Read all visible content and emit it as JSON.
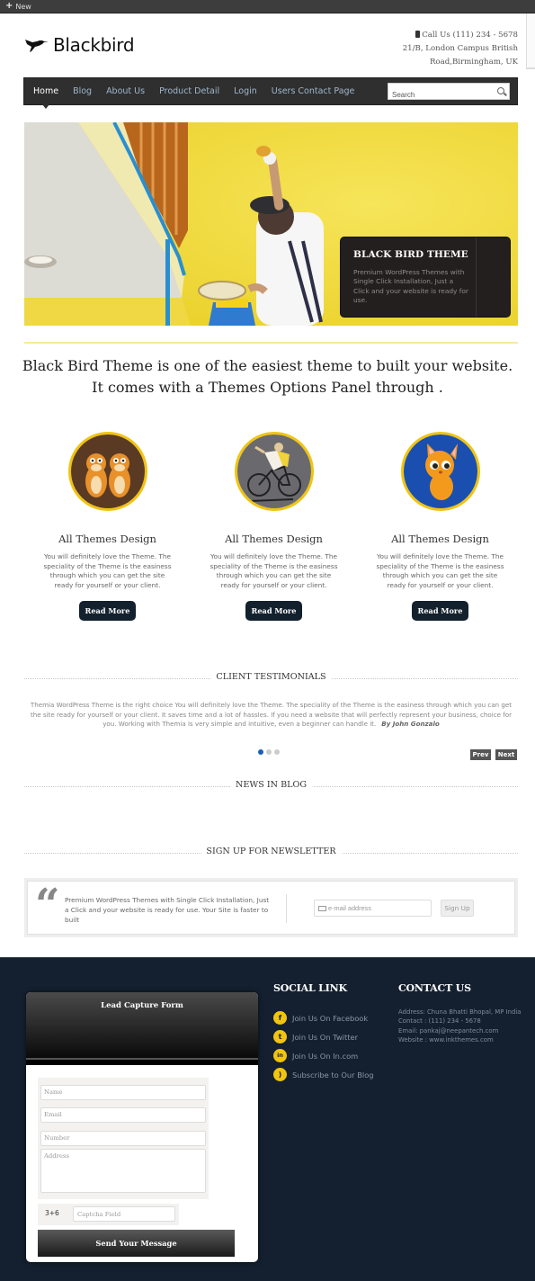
{
  "toolbar": {
    "new_label": "New"
  },
  "header": {
    "brand": "Blackbird",
    "phone": "Call Us (111) 234 - 5678",
    "address_line1": "21/B, London Campus British",
    "address_line2": "Road,Birmingham, UK"
  },
  "nav": {
    "items": [
      {
        "label": "Home",
        "active": true
      },
      {
        "label": "Blog"
      },
      {
        "label": "About Us"
      },
      {
        "label": "Product Detail"
      },
      {
        "label": "Login"
      },
      {
        "label": "Users Contact Page"
      }
    ],
    "search_placeholder": "Search"
  },
  "slider": {
    "caption_title": "BLACK BIRD THEME",
    "caption_text": "Premium WordPress Themes with Single Click Installation, Just a Click and your website is ready for use."
  },
  "tagline": {
    "line1": "Black Bird Theme is one of the easiest theme to built your website.",
    "line2": "It comes with a Themes Options Panel through ."
  },
  "features": [
    {
      "image": "tigers-illustration",
      "title": "All Themes Design",
      "text": "You will definitely love the Theme. The speciality of the Theme is the easiness through which you can get the site ready for yourself or your client.",
      "button": "Read More"
    },
    {
      "image": "cyclist-illustration",
      "title": "All Themes Design",
      "text": "You will definitely love the Theme. The speciality of the Theme is the easiness through which you can get the site ready for yourself or your client.",
      "button": "Read More"
    },
    {
      "image": "kitten-illustration",
      "title": "All Themes Design",
      "text": "You will definitely love the Theme. The speciality of the Theme is the easiness through which you can get the site ready for yourself or your client.",
      "button": "Read More"
    }
  ],
  "testimonials": {
    "title": "CLIENT TESTIMONIALS",
    "text": "Themia WordPress Theme is the right choice You will definitely love the Theme. The speciality of the Theme is the easiness through which you can get the site ready for yourself or your client. It saves time and a lot of hassles. If you need a website that will perfectly represent your business, choice for you. Working with Themia is very simple and intuitive, even a beginner can handle it.",
    "author": "By John Gonzalo",
    "slide_count": 3,
    "active_slide": 1,
    "prev_label": "Prev",
    "next_label": "Next"
  },
  "blog": {
    "title": "NEWS IN BLOG"
  },
  "newsletter": {
    "title": "SIGN UP FOR NEWSLETTER",
    "text": "Premium WordPress Themes with Single Click Installation, Just a Click and your website is ready for use. Your Site is faster to built",
    "email_placeholder": "e-mail address",
    "button": "Sign Up"
  },
  "lead_form": {
    "title": "Lead Capture Form",
    "name_placeholder": "Name",
    "email_placeholder": "Email",
    "number_placeholder": "Number",
    "address_placeholder": "Address",
    "captcha_question": "3+6",
    "captcha_placeholder": "Captcha Field",
    "submit": "Send Your Message"
  },
  "social": {
    "title": "SOCIAL LINK",
    "links": [
      {
        "icon": "facebook-icon",
        "glyph": "f",
        "label": "Join Us On Facebook"
      },
      {
        "icon": "twitter-icon",
        "glyph": "t",
        "label": "Join Us On Twitter"
      },
      {
        "icon": "linkedin-icon",
        "glyph": "in",
        "label": "Join Us On In.com"
      },
      {
        "icon": "rss-icon",
        "glyph": ")",
        "label": "Subscribe to Our Blog"
      }
    ]
  },
  "contact": {
    "title": "CONTACT US",
    "address": "Address: Chuna Bhatti Bhopal, MP India",
    "phone": "Contact : (111) 234 - 5678",
    "email": "Email: pankaj@neepantech.com",
    "website": "Website : www.inkthemes.com"
  },
  "colors": {
    "accent": "#f1c40f",
    "footer_bg": "#14202f",
    "nav_bg": "#2f2f2f",
    "button_bg": "#13202d",
    "active_dot": "#1a5fb4"
  }
}
